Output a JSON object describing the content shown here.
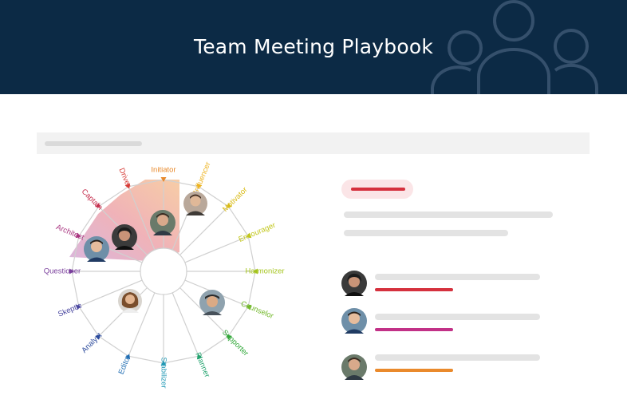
{
  "header": {
    "title": "Team Meeting Playbook"
  },
  "wheel": {
    "roles": [
      {
        "label": "Initiator",
        "color": "#e8892a"
      },
      {
        "label": "Influencer",
        "color": "#edb320"
      },
      {
        "label": "Motivator",
        "color": "#d9bb15"
      },
      {
        "label": "Encourager",
        "color": "#c2c71c"
      },
      {
        "label": "Harmonizer",
        "color": "#a4c41c"
      },
      {
        "label": "Counselor",
        "color": "#72b82a"
      },
      {
        "label": "Supporter",
        "color": "#32a83a"
      },
      {
        "label": "Planner",
        "color": "#23a36f"
      },
      {
        "label": "Stabilizer",
        "color": "#2299b5"
      },
      {
        "label": "Editor",
        "color": "#1e6cb2"
      },
      {
        "label": "Analyst",
        "color": "#2b4a9c"
      },
      {
        "label": "Skeptic",
        "color": "#4a47a0"
      },
      {
        "label": "Questioner",
        "color": "#7a3f9c"
      },
      {
        "label": "Architect",
        "color": "#a8337f"
      },
      {
        "label": "Captain",
        "color": "#c6304f"
      },
      {
        "label": "Driver",
        "color": "#d63b36"
      }
    ]
  },
  "panel": {
    "members": [
      {
        "name_color": "#d5313e"
      },
      {
        "name_color": "#c23187"
      },
      {
        "name_color": "#ea8a2c"
      }
    ]
  }
}
